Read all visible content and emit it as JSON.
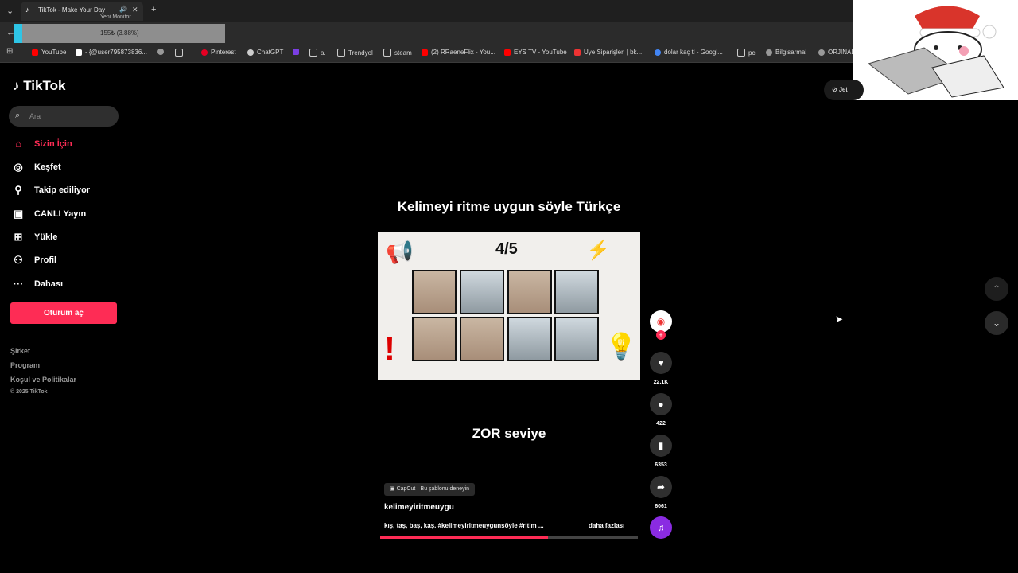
{
  "browser": {
    "tab_title": "TikTok - Make Your Day",
    "tab_sub": "Yeni Monitor",
    "overlay_text": "155₺ (3.88%)",
    "bookmarks": [
      "YouTube",
      "- {@user795873836...",
      "Pinterest",
      "ChatGPT",
      "a.",
      "Trendyol",
      "steam",
      "(2) RRaeneFlix - You...",
      "EYS TV - YouTube",
      "Üye Siparişleri | bk...",
      "dolar kaç tl - Googl...",
      "pc",
      "Bilgisarmal",
      "ORJINAL"
    ]
  },
  "sidebar": {
    "logo": "TikTok",
    "search_placeholder": "Ara",
    "nav": [
      "Sizin İçin",
      "Keşfet",
      "Takip ediliyor",
      "CANLI Yayın",
      "Yükle",
      "Profil",
      "Dahası"
    ],
    "login": "Oturum aç",
    "footer": [
      "Şirket",
      "Program",
      "Koşul ve Politikalar",
      "© 2025 TikTok"
    ]
  },
  "video": {
    "title": "Kelimeyi ritme uygun söyle Türkçe",
    "counter": "4/5",
    "level": "ZOR seviye",
    "capcut": "CapCut · Bu şablonu deneyin",
    "author": "kelimeyiritmeuygu",
    "description": "kış, taş, baş, kaş.  #kelimeyiritmeuygunsöyle #ritim ...",
    "more": "daha fazlası",
    "progress": 0.65
  },
  "actions": {
    "likes": "22.1K",
    "comments": "422",
    "saves": "6353",
    "shares": "6061"
  },
  "top_right": {
    "jet": "Jet"
  },
  "colors": {
    "accent": "#fe2c55"
  }
}
